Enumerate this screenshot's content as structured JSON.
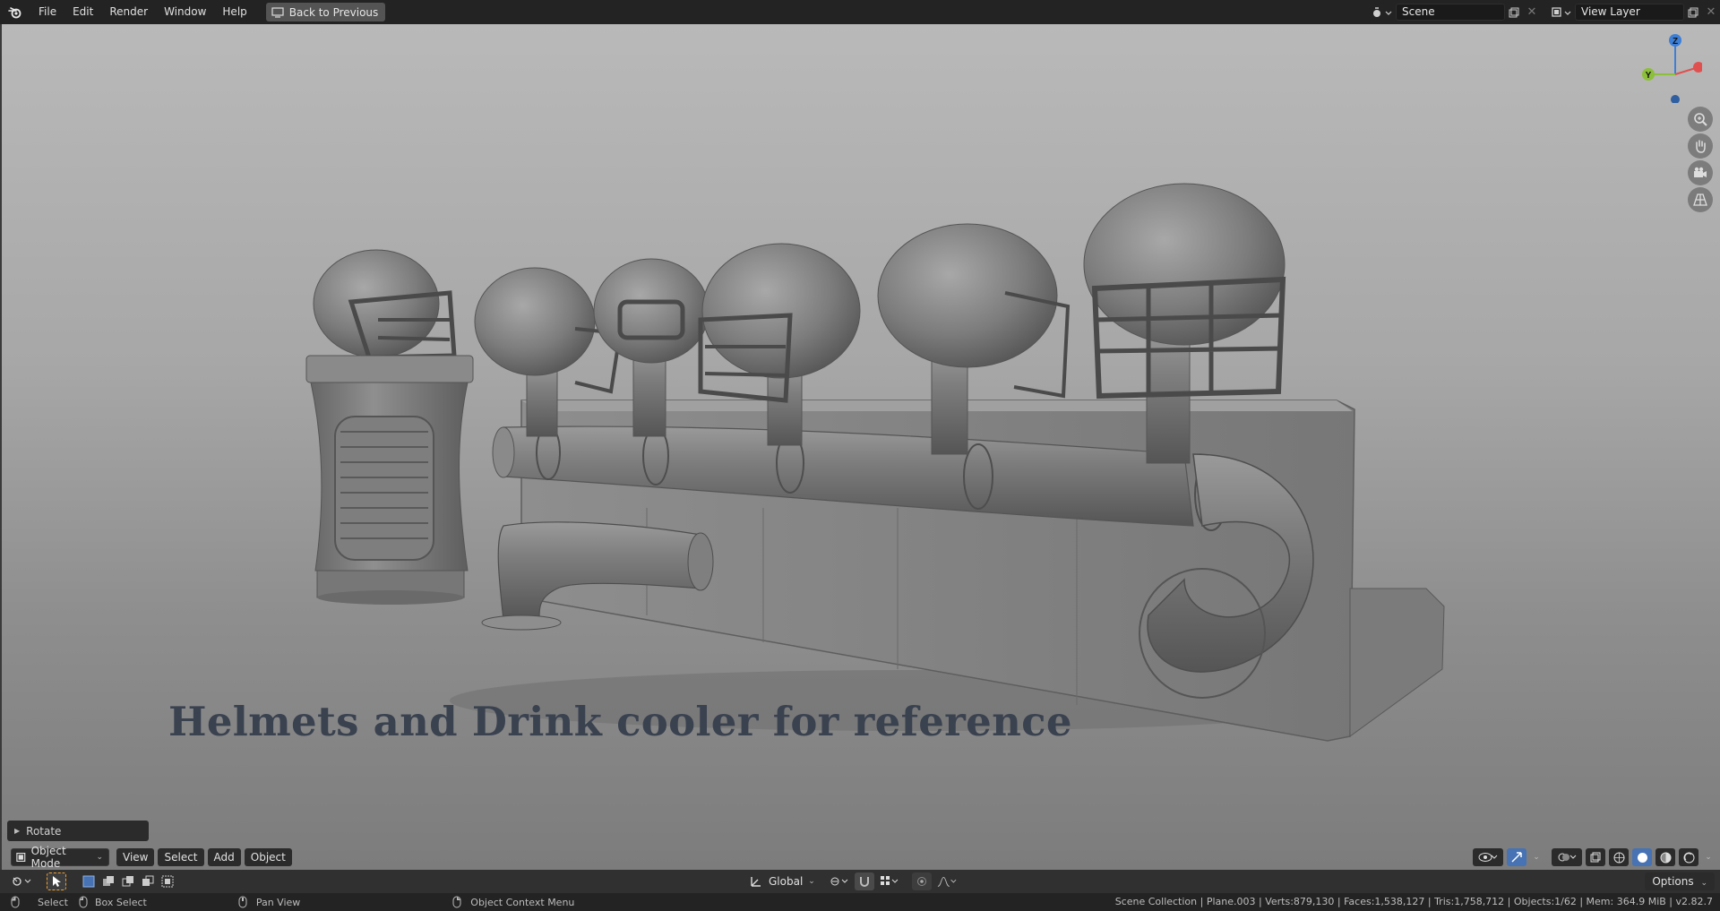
{
  "topbar": {
    "menus": [
      "File",
      "Edit",
      "Render",
      "Window",
      "Help"
    ],
    "back_label": "Back to Previous",
    "scene_name": "Scene",
    "view_layer": "View Layer"
  },
  "viewport": {
    "caption": "Helmets and Drink cooler for reference",
    "gizmo": {
      "z": "Z",
      "y": "Y"
    },
    "operator_panel": "Rotate"
  },
  "viewport_header": {
    "mode": "Object Mode",
    "menus": [
      "View",
      "Select",
      "Add",
      "Object"
    ]
  },
  "toolbar": {
    "transform_orientation": "Global",
    "options_label": "Options"
  },
  "statusbar": {
    "select": "Select",
    "box_select": "Box Select",
    "pan_view": "Pan View",
    "context_menu": "Object Context Menu",
    "stats": "Scene Collection | Plane.003 | Verts:879,130 | Faces:1,538,127 | Tris:1,758,712 | Objects:1/62 | Mem: 364.9 MiB | v2.82.7"
  },
  "colors": {
    "axis_x": "#e0504f",
    "axis_y": "#8cbf3a",
    "axis_z": "#3d7fd6",
    "selection": "#f0a030",
    "header_bg": "#232323"
  }
}
